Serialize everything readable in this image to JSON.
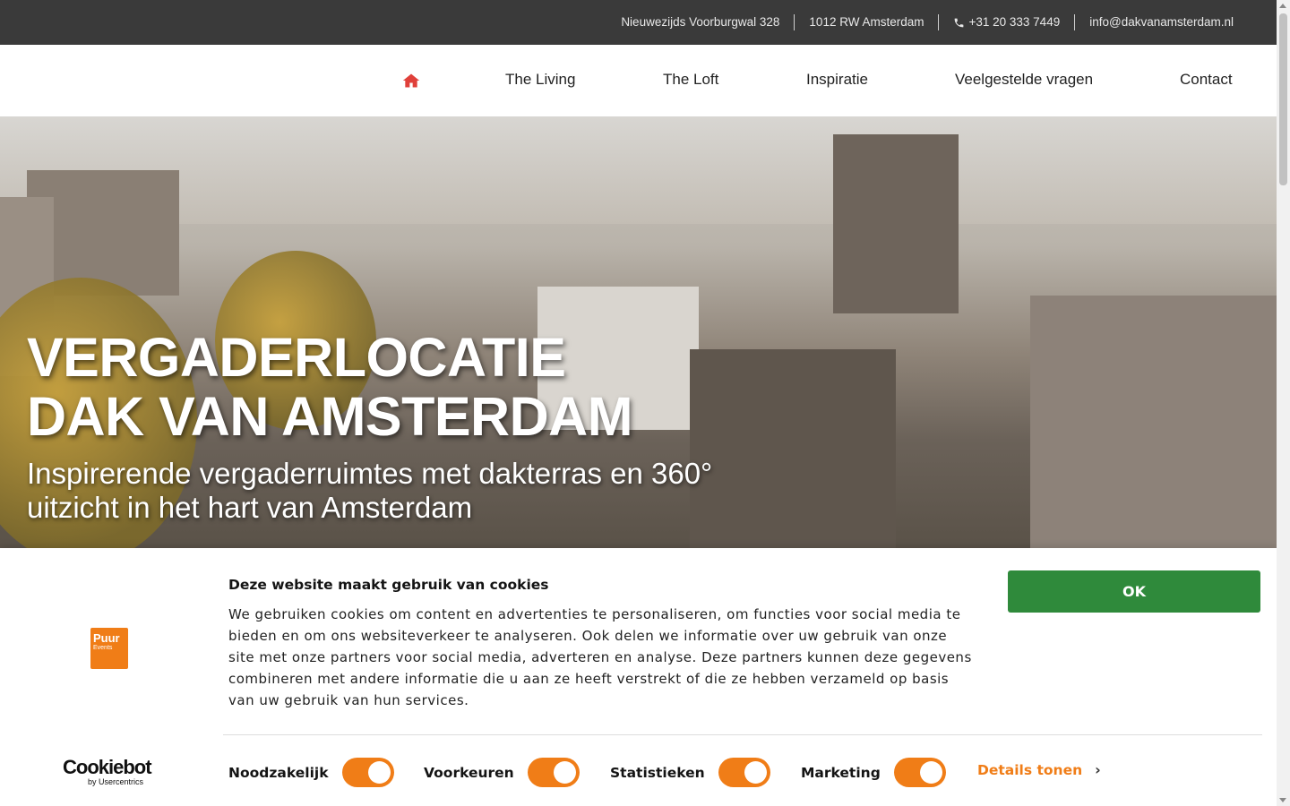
{
  "topbar": {
    "address": "Nieuwezijds Voorburgwal 328",
    "postcode": "1012 RW Amsterdam",
    "phone": "+31 20 333 7449",
    "email": "info@dakvanamsterdam.nl"
  },
  "nav": {
    "home_icon": "home-icon",
    "items": [
      {
        "label": "The Living"
      },
      {
        "label": "The Loft"
      },
      {
        "label": "Inspiratie"
      },
      {
        "label": "Veelgestelde vragen"
      },
      {
        "label": "Contact"
      }
    ]
  },
  "hero": {
    "title_line1": "VERGADERLOCATIE",
    "title_line2": "DAK VAN AMSTERDAM",
    "subtitle": "Inspirerende vergaderruimtes met dakterras en 360° uitzicht in het hart van Amsterdam"
  },
  "cookie": {
    "logo_text": "Puur",
    "logo_sub": "Events",
    "title": "Deze website maakt gebruik van cookies",
    "text": "We gebruiken cookies om content en advertenties te personaliseren, om functies voor social media te bieden en om ons websiteverkeer te analyseren. Ook delen we informatie over uw gebruik van onze site met onze partners voor social media, adverteren en analyse. Deze partners kunnen deze gegevens combineren met andere informatie die u aan ze heeft verstrekt of die ze hebben verzameld op basis van uw gebruik van hun services.",
    "ok_label": "OK",
    "brand": "Cookiebot",
    "brand_by": "by Usercentrics",
    "options": [
      {
        "label": "Noodzakelijk",
        "enabled": true
      },
      {
        "label": "Voorkeuren",
        "enabled": true
      },
      {
        "label": "Statistieken",
        "enabled": true
      },
      {
        "label": "Marketing",
        "enabled": true
      }
    ],
    "details_label": "Details tonen",
    "accent_color": "#f07d17",
    "ok_color": "#2f8a3b"
  }
}
